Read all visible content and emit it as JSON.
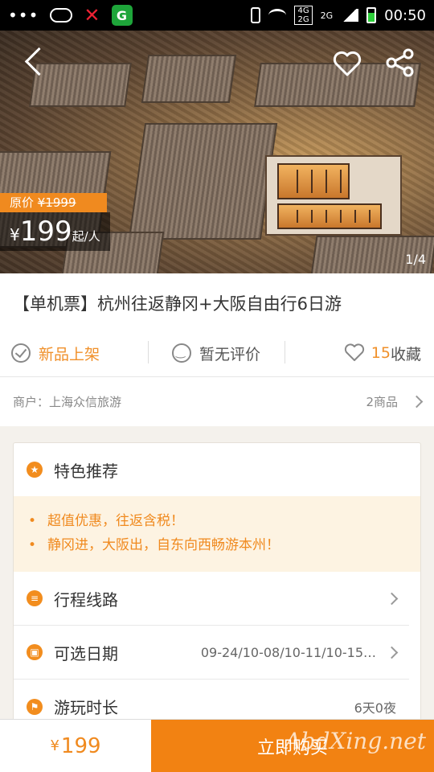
{
  "status_bar": {
    "time": "00:50",
    "network_top": "4G",
    "network_bottom": "2G",
    "network2": "2G"
  },
  "hero": {
    "original_price_label": "原价",
    "original_price": "¥1999",
    "price_currency": "¥",
    "price": "199",
    "price_unit": "起/人",
    "pager": "1/4"
  },
  "product": {
    "title": "【单机票】杭州往返静冈+大阪自由行6日游"
  },
  "stats": {
    "new_label": "新品上架",
    "review_label": "暂无评价",
    "fav_count": "15",
    "fav_label": "收藏"
  },
  "merchant": {
    "label": "商户：上海众信旅游",
    "count": "2商品"
  },
  "features": {
    "heading": "特色推荐",
    "highlights": [
      "超值优惠，往返含税！",
      "静冈进，大阪出，自东向西畅游本州！"
    ]
  },
  "rows": {
    "route_label": "行程线路",
    "dates_label": "可选日期",
    "dates_value": "09-24/10-08/10-11/10-15…",
    "duration_label": "游玩时长",
    "duration_value": "6天0夜"
  },
  "bottom": {
    "currency": "¥",
    "price": "199",
    "buy_label": "立即购买",
    "watermark": "AbdXing.net"
  },
  "colors": {
    "accent": "#f28212",
    "highlight_bg": "#fdf3e2"
  }
}
